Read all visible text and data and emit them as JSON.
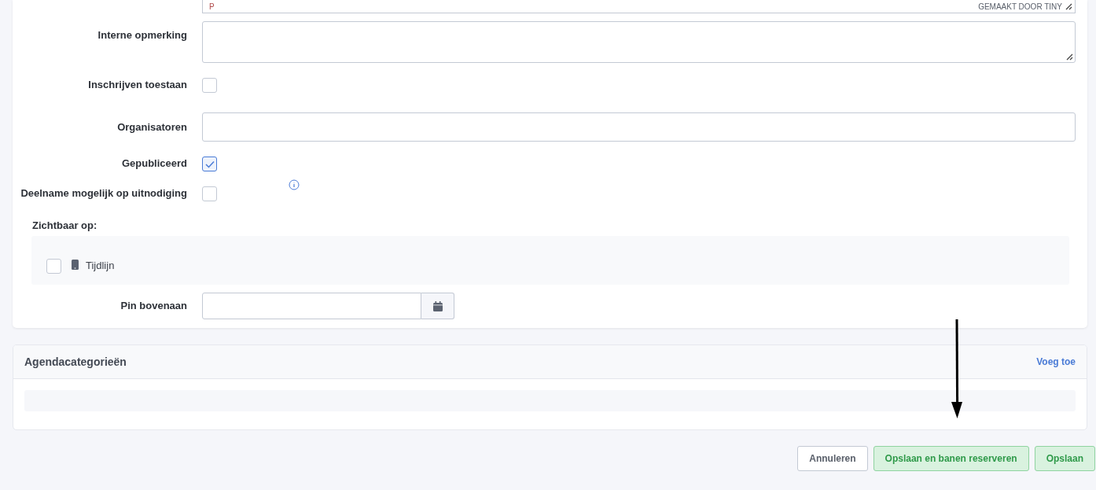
{
  "editor_status": {
    "path": "P",
    "credit": "GEMAAKT DOOR TINY"
  },
  "fields": [
    {
      "kind": "textarea",
      "label": "Interne opmerking"
    },
    {
      "kind": "checkbox",
      "label": "Inschrijven toestaan",
      "checked": false
    },
    {
      "kind": "text",
      "label": "Organisatoren"
    },
    {
      "kind": "checkbox",
      "label": "Gepubliceerd",
      "checked": true
    },
    {
      "kind": "checkbox",
      "label": "Deelname mogelijk op uitnodiging",
      "checked": false,
      "info": true
    }
  ],
  "visible_on": {
    "label": "Zichtbaar op:",
    "options": [
      {
        "label": "Tijdlijn",
        "checked": false
      }
    ]
  },
  "pin": {
    "label": "Pin bovenaan"
  },
  "categories": {
    "title": "Agendacategorieën",
    "action": "Voeg toe"
  },
  "buttons": [
    {
      "label": "Annuleren",
      "kind": "secondary"
    },
    {
      "label": "Opslaan en banen reserveren",
      "kind": "success"
    },
    {
      "label": "Opslaan",
      "kind": "success"
    }
  ]
}
